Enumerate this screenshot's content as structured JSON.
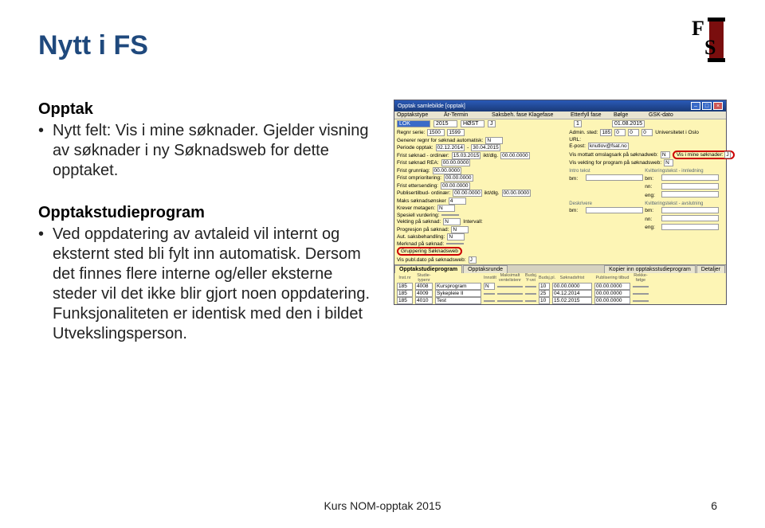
{
  "slide": {
    "title": "Nytt i FS",
    "section1_heading": "Opptak",
    "bullet1": "Nytt felt: Vis i mine søknader. Gjelder visning av søknader i ny Søknadsweb for dette opptaket.",
    "section2_heading": "Opptakstudieprogram",
    "bullet2": "Ved oppdatering av avtaleid vil internt og eksternt sted bli fylt inn automatisk. Dersom det finnes flere interne og/eller eksterne steder vil det ikke blir gjort noen oppdatering. Funksjonaliteten er identisk med den i bildet Utvekslingsperson.",
    "footer_text": "Kurs NOM-opptak 2015",
    "page_number": "6"
  },
  "window": {
    "title": "Opptak samlebilde [opptak]",
    "header_labels": [
      "Opptakstype",
      "År-Termin",
      "Saksbeh. fase Klagefase",
      "Etterfyll fase",
      "Bølge",
      "GSK-dato"
    ],
    "row1": {
      "opptakstype": "LOK",
      "ar": "2015",
      "termin": "HØST",
      "nbox": "J",
      "bolge": "1",
      "gsk": "01.08.2015"
    },
    "left_rows": [
      {
        "lbl": "Regnr serie:",
        "val": "1500",
        "val2": "1599"
      },
      {
        "lbl": "Generer regnr for søknad automatisk:",
        "val": "N"
      },
      {
        "lbl": "Periode opptak:",
        "val": "02.12.2014",
        "sep": "-",
        "val2": "30.04.2015"
      },
      {
        "lbl": "Frist søknad - ordinær:",
        "val": "15.03.2015",
        "suf": "ikt/dlg.",
        "val2": "00.00.0000"
      },
      {
        "lbl": "Frist søknad REA:",
        "val": "00.00.0000"
      },
      {
        "lbl": "Frist grunnlag:",
        "val": "00.00.0000"
      },
      {
        "lbl": "Frist omprioritering:",
        "val": "00.00.0000"
      },
      {
        "lbl": "Frist ettersending:",
        "val": "00.00.0000"
      },
      {
        "lbl": "Publisertilbud- ordinær:",
        "val": "00.00.0000",
        "suf": "ikt/dlg.",
        "val2": "00.00.0000"
      },
      {
        "lbl": "Maks søknadsønsker",
        "val": "4"
      },
      {
        "lbl": "Krever metagen:",
        "val": "N"
      },
      {
        "lbl": "Spesiell vurdering:",
        "val": ""
      },
      {
        "lbl": "Vekting på søknad:",
        "val": "N",
        "suf": "Intervall:"
      },
      {
        "lbl": "Progresjon på søknad:",
        "val": "N"
      },
      {
        "lbl": "Aut. saksbehandling:",
        "val": "N"
      },
      {
        "lbl": "Merknad på søknad:",
        "val": ""
      },
      {
        "lbl": "Gruppering Søknadsweb",
        "highlight": true
      }
    ],
    "right_rows": [
      {
        "lbl": "Admin. sted:",
        "vals": [
          "185",
          "0",
          "0",
          "0"
        ],
        "tail": "Universitetet i Oslo"
      },
      {
        "lbl": "URL:"
      },
      {
        "lbl": "E-post:",
        "val": "knutlov@fsat.no"
      },
      {
        "lbl": "Vis mottatt omslagsark på søknadweb:",
        "val": "N",
        "pill_lbl": "Vis i mine søknader:",
        "pill_val": "J",
        "highlight": true
      },
      {
        "lbl": "Vis vekting for program på søknadsweb:",
        "val": "N"
      }
    ],
    "side_sections": [
      {
        "title": "Intro tekst",
        "rows": [
          "bm:"
        ]
      },
      {
        "title": "Kvitteringstekst - innledning",
        "rows": [
          "bm:",
          "nn:",
          "eng:"
        ]
      },
      {
        "title": "Deskrivere",
        "rows": [
          "bm:"
        ]
      },
      {
        "title": "Kvitteringstekst - avslutning",
        "rows": [
          "bm:",
          "nn:",
          "eng:"
        ]
      }
    ],
    "mid_box_label": "Vis publ.dato på søknadsweb:",
    "mid_box_val": "J",
    "tabs": [
      "Opptakstudieprogram",
      "Opptaksrunde"
    ],
    "tabs_right": [
      "Kopier inn opptaksstudieprogram",
      "Detaljer"
    ],
    "table_headers": [
      "Inst.nr",
      "Studie-typenr",
      "",
      "Innstilt",
      "Maksimalt ventelistenr",
      "Budsj. Y-vei",
      "Budsj.pl.",
      "Søknadsfrist",
      "Publisering tilbud",
      "Rekke-følge"
    ],
    "table_rows": [
      {
        "inst": "185",
        "type": "4008",
        "navn": "Kursprogram",
        "inn": "N",
        "maks": "",
        "yv": "",
        "bud": "10",
        "frist": "00.00.0000",
        "pub": "00.00.0000",
        "rk": ""
      },
      {
        "inst": "185",
        "type": "4009",
        "navn": "Sykepleie II",
        "inn": "",
        "maks": "",
        "yv": "",
        "bud": "25",
        "frist": "04.12.2014",
        "pub": "00.00.0000",
        "rk": ""
      },
      {
        "inst": "185",
        "type": "4010",
        "navn": "Test",
        "inn": "",
        "maks": "",
        "yv": "",
        "bud": "10",
        "frist": "15.02.2015",
        "pub": "00.00.0000",
        "rk": ""
      }
    ]
  }
}
